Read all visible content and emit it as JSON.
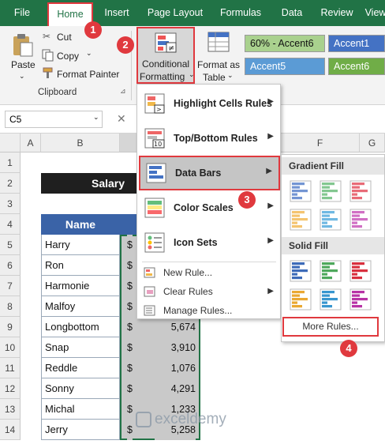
{
  "tabs": [
    {
      "label": "File"
    },
    {
      "label": "Home"
    },
    {
      "label": "Insert"
    },
    {
      "label": "Page Layout"
    },
    {
      "label": "Formulas"
    },
    {
      "label": "Data"
    },
    {
      "label": "Review"
    },
    {
      "label": "View"
    }
  ],
  "ribbon": {
    "paste": "Paste",
    "cut": "Cut",
    "copy": "Copy",
    "format_painter": "Format Painter",
    "clipboard": "Clipboard",
    "cond_fmt_1": "Conditional",
    "cond_fmt_2": "Formatting",
    "format_table_1": "Format as",
    "format_table_2": "Table",
    "styles": [
      "60% - Accent6",
      "Accent1",
      "Accent5",
      "Accent6"
    ]
  },
  "formula_bar": {
    "name_box": "C5"
  },
  "columns": [
    "A",
    "B",
    "F",
    "G"
  ],
  "rows": [
    "1",
    "2",
    "3",
    "4",
    "5",
    "6",
    "7",
    "8",
    "9",
    "10",
    "11",
    "12",
    "13",
    "14"
  ],
  "sheet": {
    "title": "Salary Li",
    "header": "Name",
    "names": [
      "Harry",
      "Ron",
      "Harmonie",
      "Malfoy",
      "Longbottom",
      "Snap",
      "Reddle",
      "Sonny",
      "Michal",
      "Jerry"
    ],
    "currency": "$",
    "amounts": [
      "",
      "",
      "",
      "",
      "5,674",
      "3,910",
      "1,076",
      "4,291",
      "1,233",
      "5,258"
    ]
  },
  "menu": {
    "items": [
      {
        "label": "Highlight Cells Rules"
      },
      {
        "label": "Top/Bottom Rules"
      },
      {
        "label": "Data Bars"
      },
      {
        "label": "Color Scales"
      },
      {
        "label": "Icon Sets"
      }
    ],
    "small_items": [
      {
        "label": "New Rule..."
      },
      {
        "label": "Clear Rules"
      },
      {
        "label": "Manage Rules..."
      }
    ]
  },
  "submenu": {
    "gradient": "Gradient Fill",
    "solid": "Solid Fill",
    "more": "More Rules..."
  },
  "steps": [
    "1",
    "2",
    "3",
    "4"
  ],
  "watermark": "exceldemy",
  "colors": {
    "ribbon_green": "#217346",
    "step_red": "#e0393e",
    "header_blue": "#4472c4",
    "accent6": "#70ad47",
    "accent1": "#4472c4",
    "accent5": "#5b9bd5"
  }
}
